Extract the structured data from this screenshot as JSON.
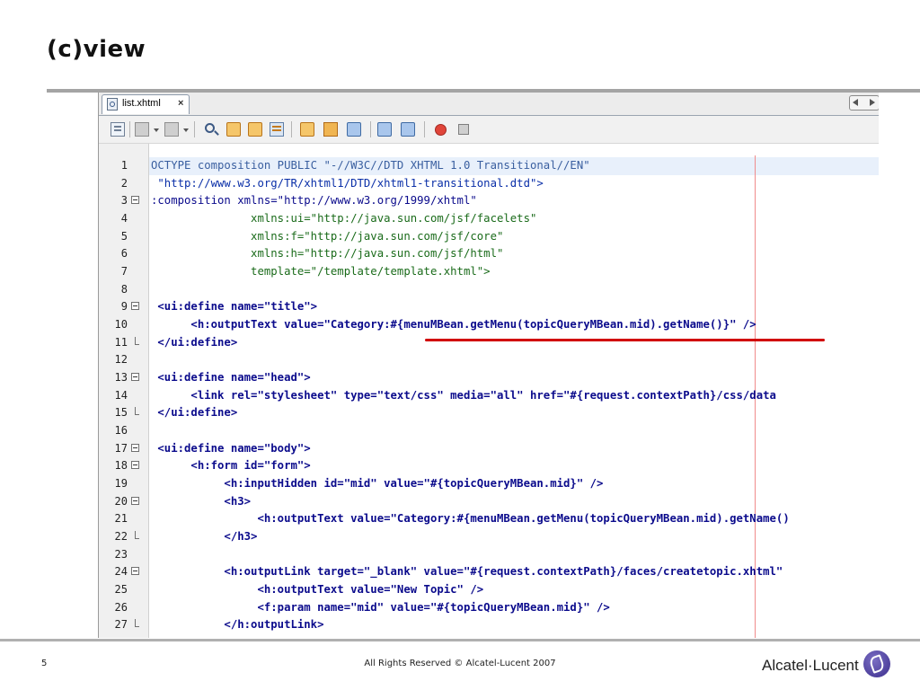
{
  "slide": {
    "title": "(c)view",
    "page_number": "5",
    "copyright": "All Rights Reserved © Alcatel-Lucent 2007",
    "logo_text": "Alcatel·Lucent"
  },
  "ide": {
    "tab_label": "list.xhtml",
    "tab_close": "×",
    "toolbar_icons": [
      "toggle-bookmark-icon",
      "previous-bookmark-icon",
      "next-bookmark-icon",
      "find-icon",
      "find-previous-icon",
      "find-next-icon",
      "toggle-highlight-icon",
      "previous-error-icon",
      "next-error-icon",
      "toggle-rect-icon",
      "shift-left-icon",
      "shift-right-icon",
      "record-macro-icon",
      "stop-macro-icon"
    ]
  },
  "colors": {
    "tag": "#0b0b8c",
    "attribute": "#1a6b1a",
    "string": "#c3661c",
    "url": "#0a2fa8",
    "annotation_underline": "#d10000"
  },
  "code_lines": [
    {
      "n": "1",
      "text": "OCTYPE composition PUBLIC \"-//W3C//DTD XHTML 1.0 Transitional//EN\""
    },
    {
      "n": "2",
      "text": " \"http://www.w3.org/TR/xhtml1/DTD/xhtml1-transitional.dtd\">"
    },
    {
      "n": "3",
      "text": ":composition xmlns=\"http://www.w3.org/1999/xhtml\""
    },
    {
      "n": "4",
      "text": "               xmlns:ui=\"http://java.sun.com/jsf/facelets\""
    },
    {
      "n": "5",
      "text": "               xmlns:f=\"http://java.sun.com/jsf/core\""
    },
    {
      "n": "6",
      "text": "               xmlns:h=\"http://java.sun.com/jsf/html\""
    },
    {
      "n": "7",
      "text": "               template=\"/template/template.xhtml\">"
    },
    {
      "n": "8",
      "text": ""
    },
    {
      "n": "9",
      "text": " <ui:define name=\"title\">"
    },
    {
      "n": "10",
      "text": "      <h:outputText value=\"Category:#{menuMBean.getMenu(topicQueryMBean.mid).getName()}\" />"
    },
    {
      "n": "11",
      "text": " </ui:define>"
    },
    {
      "n": "12",
      "text": ""
    },
    {
      "n": "13",
      "text": " <ui:define name=\"head\">"
    },
    {
      "n": "14",
      "text": "      <link rel=\"stylesheet\" type=\"text/css\" media=\"all\" href=\"#{request.contextPath}/css/data"
    },
    {
      "n": "15",
      "text": " </ui:define>"
    },
    {
      "n": "16",
      "text": ""
    },
    {
      "n": "17",
      "text": " <ui:define name=\"body\">"
    },
    {
      "n": "18",
      "text": "      <h:form id=\"form\">"
    },
    {
      "n": "19",
      "text": "           <h:inputHidden id=\"mid\" value=\"#{topicQueryMBean.mid}\" />"
    },
    {
      "n": "20",
      "text": "           <h3>"
    },
    {
      "n": "21",
      "text": "                <h:outputText value=\"Category:#{menuMBean.getMenu(topicQueryMBean.mid).getName()"
    },
    {
      "n": "22",
      "text": "           </h3>"
    },
    {
      "n": "23",
      "text": ""
    },
    {
      "n": "24",
      "text": "           <h:outputLink target=\"_blank\" value=\"#{request.contextPath}/faces/createtopic.xhtml\""
    },
    {
      "n": "25",
      "text": "                <h:outputText value=\"New Topic\" />"
    },
    {
      "n": "26",
      "text": "                <f:param name=\"mid\" value=\"#{topicQueryMBean.mid}\" />"
    },
    {
      "n": "27",
      "text": "           </h:outputLink>"
    }
  ]
}
